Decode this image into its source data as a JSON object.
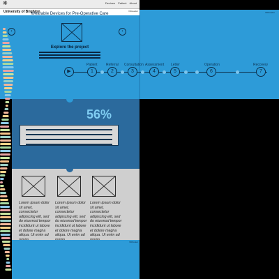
{
  "nav": {
    "logo_icon": "crest-icon",
    "links": [
      "Devices",
      "Patient",
      "About"
    ],
    "brand": "University of Brighton",
    "version": "VDHeader"
  },
  "hero": {
    "title": "Wearable Devices for Pre-Operative Care",
    "explore_label": "Explore the project",
    "version": "VDHeader",
    "bg_color": "#2d9bd8"
  },
  "timeline": {
    "steps": [
      {
        "number": "1",
        "label": "Patient"
      },
      {
        "number": "2",
        "label": "Referral"
      },
      {
        "number": "3",
        "label": "Consultation"
      },
      {
        "number": "4",
        "label": "Assessment"
      },
      {
        "number": "5",
        "label": "Letter"
      },
      {
        "number": "6",
        "label": "Operation"
      },
      {
        "number": "7",
        "label": "Recovery"
      }
    ]
  },
  "stats": {
    "percent": "56%"
  },
  "cards": [
    {
      "text": "Lorem ipsum dolor sit amet, consectetur adipiscing elit, sed do eiusmod tempor incididunt ut labore et dolore magna aliqua. Ut enim ad minim"
    },
    {
      "text": "Lorem ipsum dolor sit amet, consectetur adipiscing elit, sed do eiusmod tempor incididunt ut labore et dolore magna aliqua. Ut enim ad minim"
    },
    {
      "text": "Lorem ipsum dolor sit amet, consectetur adipiscing elit, sed do eiusmod tempor incididunt ut labore et dolore magna aliqua. Ut enim ad minim"
    }
  ],
  "footer": {
    "version": "VDFooter"
  }
}
